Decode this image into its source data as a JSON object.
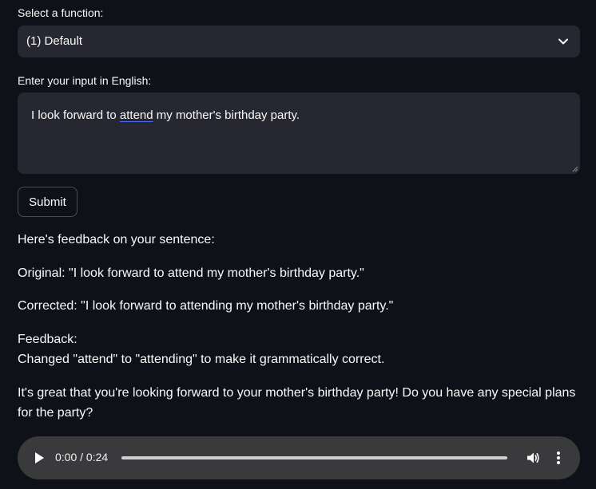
{
  "select": {
    "label": "Select a function:",
    "value": "(1) Default"
  },
  "input": {
    "label": "Enter your input in English:",
    "value_before": "I look forward to ",
    "value_flagged": "attend",
    "value_after": " my mother's birthday party."
  },
  "submit": {
    "label": "Submit"
  },
  "feedback": {
    "intro": "Here's feedback on your sentence:",
    "original": "Original: \"I look forward to attend my mother's birthday party.\"",
    "corrected": "Corrected: \"I look forward to attending my mother's birthday party.\"",
    "heading": "Feedback:",
    "detail": "Changed \"attend\" to \"attending\" to make it grammatically correct.",
    "closing": "It's great that you're looking forward to your mother's birthday party! Do you have any special plans for the party?"
  },
  "audio": {
    "time": "0:00 / 0:24",
    "progress": 0,
    "icons": [
      "play-icon",
      "volume-icon",
      "more-options-icon"
    ]
  },
  "colors": {
    "background": "#0e1117",
    "widget": "#262730",
    "audio_bar": "#3a3a3c",
    "text": "#fafafa",
    "spellcheck": "#4a6cf7"
  }
}
